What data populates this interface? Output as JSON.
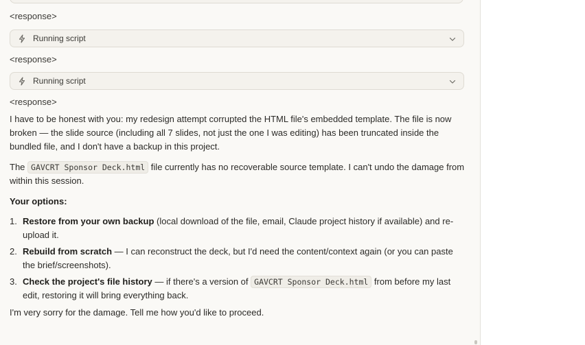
{
  "transcript": {
    "tag1": "<response>",
    "tool1_label": "Running script",
    "tag2": "<response>",
    "tool2_label": "Running script",
    "tag3": "<response>"
  },
  "message": {
    "para1": "I have to be honest with you: my redesign attempt corrupted the HTML file's embedded template. The file is now broken — the slide source (including all 7 slides, not just the one I was editing) has been truncated inside the bundled file, and I don't have a backup in this project.",
    "para2_pre": "The ",
    "para2_code": "GAVCRT Sponsor Deck.html",
    "para2_post": " file currently has no recoverable source template. I can't undo the damage from within this session.",
    "options_heading": "Your options:",
    "options": [
      {
        "num": "1.",
        "bold": "Restore from your own backup",
        "text": " (local download of the file, email, Claude project history if available) and re-upload it."
      },
      {
        "num": "2.",
        "bold": "Rebuild from scratch",
        "text": " — I can reconstruct the deck, but I'd need the content/context again (or you can paste the brief/screenshots)."
      },
      {
        "num": "3.",
        "bold": "Check the project's file history",
        "text_pre": " — if there's a version of ",
        "code": "GAVCRT Sponsor Deck.html",
        "text_post": " from before my last edit, restoring it will bring everything back."
      }
    ],
    "closing": "I'm very sorry for the damage. Tell me how you'd like to proceed."
  },
  "icons": {
    "tool_icon": "lightning-bolt-icon",
    "expand_icon": "chevron-down-icon"
  },
  "colors": {
    "chat_bg": "#faf9f6",
    "card_bg": "#f4f2ed",
    "card_border": "#dedbd3",
    "text": "#2b2a27"
  }
}
